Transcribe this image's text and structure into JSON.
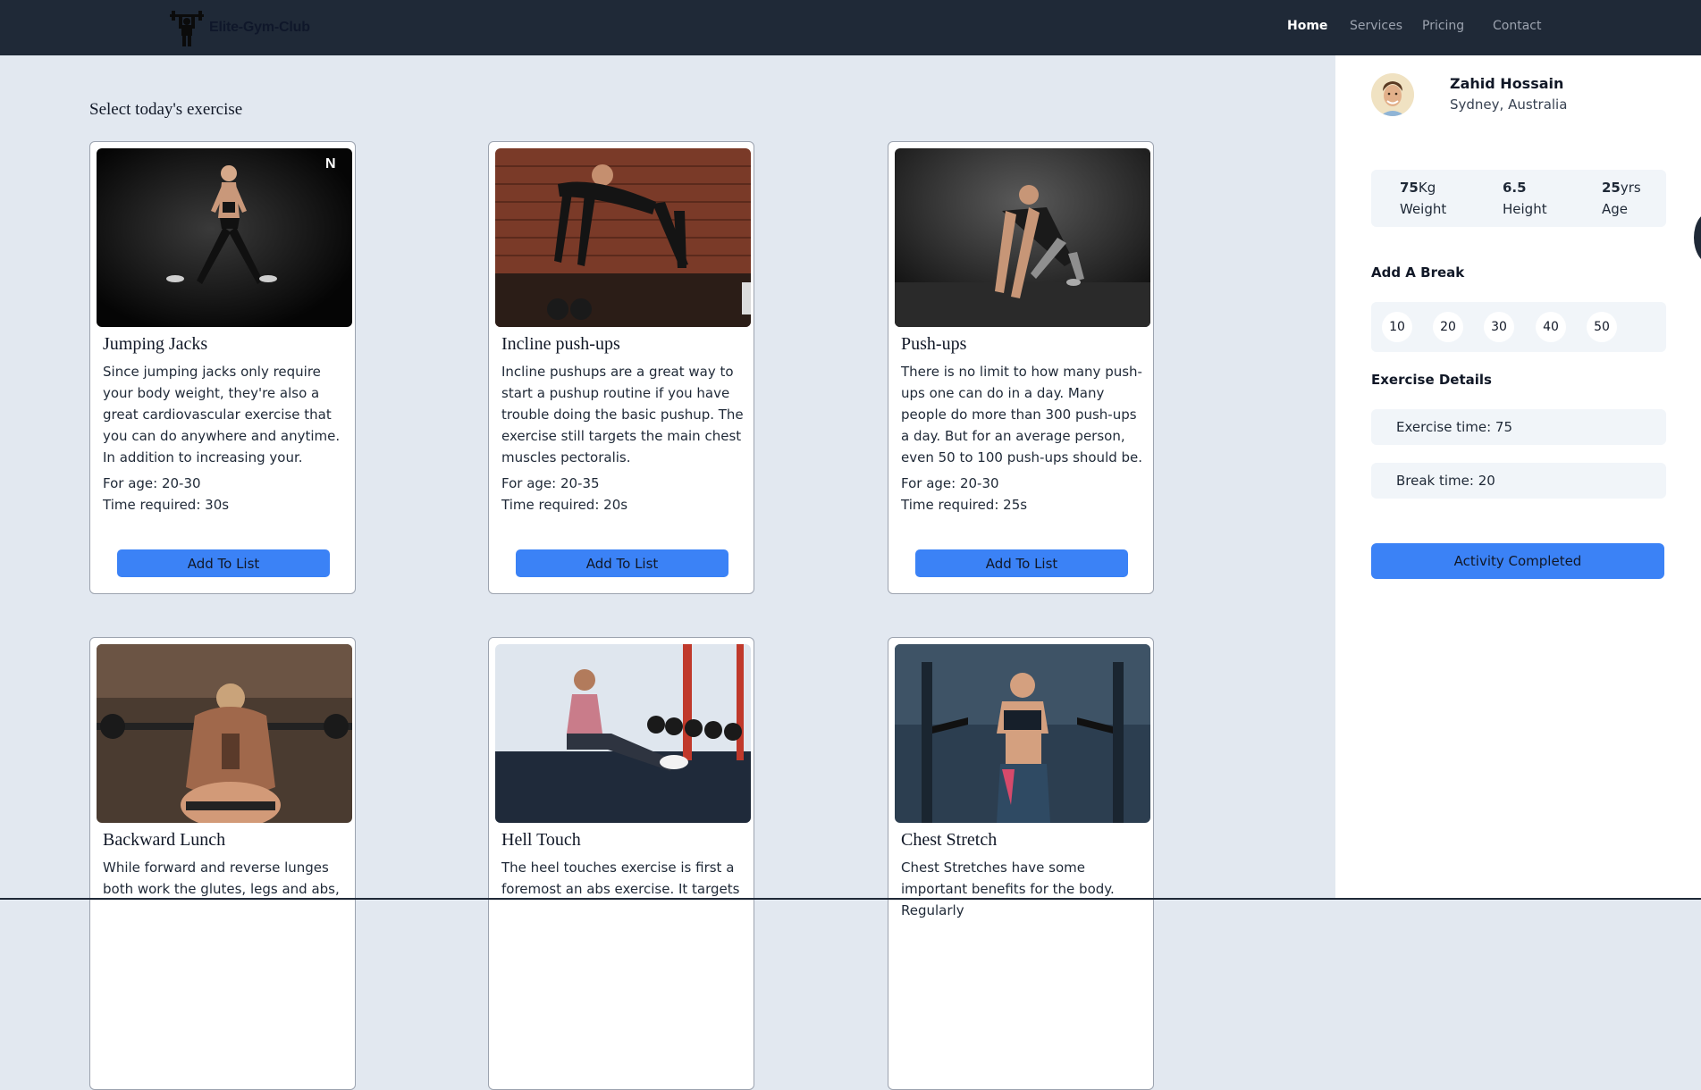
{
  "navbar": {
    "brand": "Elite-Gym-Club",
    "links": [
      {
        "label": "Home",
        "active": true
      },
      {
        "label": "Services",
        "active": false
      },
      {
        "label": "Pricing",
        "active": false
      },
      {
        "label": "Contact",
        "active": false
      }
    ]
  },
  "main": {
    "title": "Select today's exercise",
    "button_label": "Add To List",
    "exercises": [
      {
        "name": "Jumping Jacks",
        "description": "Since jumping jacks only require your body weight, they're also a great cardiovascular exercise that you can do anywhere and anytime. In addition to increasing your.",
        "age": "For age: 20-30",
        "time": "Time required: 30s"
      },
      {
        "name": "Incline push-ups",
        "description": "Incline pushups are a great way to start a pushup routine if you have trouble doing the basic pushup. The exercise still targets the main chest muscles pectoralis.",
        "age": "For age: 20-35",
        "time": "Time required: 20s"
      },
      {
        "name": "Push-ups",
        "description": "There is no limit to how many push-ups one can do in a day. Many people do more than 300 push-ups a day. But for an average person, even 50 to 100 push-ups should be.",
        "age": "For age: 20-30",
        "time": "Time required: 25s"
      },
      {
        "name": "Backward Lunch",
        "description": "While forward and reverse lunges both work the glutes, legs and abs,",
        "age": "",
        "time": ""
      },
      {
        "name": "Hell Touch",
        "description": "The heel touches exercise is first a foremost an abs exercise. It targets",
        "age": "",
        "time": ""
      },
      {
        "name": "Chest Stretch",
        "description": "Chest Stretches have some important benefits for the body. Regularly",
        "age": "",
        "time": ""
      }
    ]
  },
  "profile": {
    "name": "Zahid Hossain",
    "location": "Sydney, Australia",
    "stats": [
      {
        "value": "75",
        "unit": "Kg",
        "label": "Weight"
      },
      {
        "value": "6.5",
        "unit": "",
        "label": "Height"
      },
      {
        "value": "25",
        "unit": "yrs",
        "label": "Age"
      }
    ]
  },
  "break_section": {
    "heading": "Add A Break",
    "options": [
      "10",
      "20",
      "30",
      "40",
      "50"
    ]
  },
  "exercise_details": {
    "heading": "Exercise Details",
    "exercise_time": "Exercise time: 75",
    "break_time": "Break time: 20"
  },
  "complete_button": "Activity Completed",
  "colors": {
    "navbar": "#1f2937",
    "background": "#e2e8f0",
    "accent": "#3b82f6"
  }
}
